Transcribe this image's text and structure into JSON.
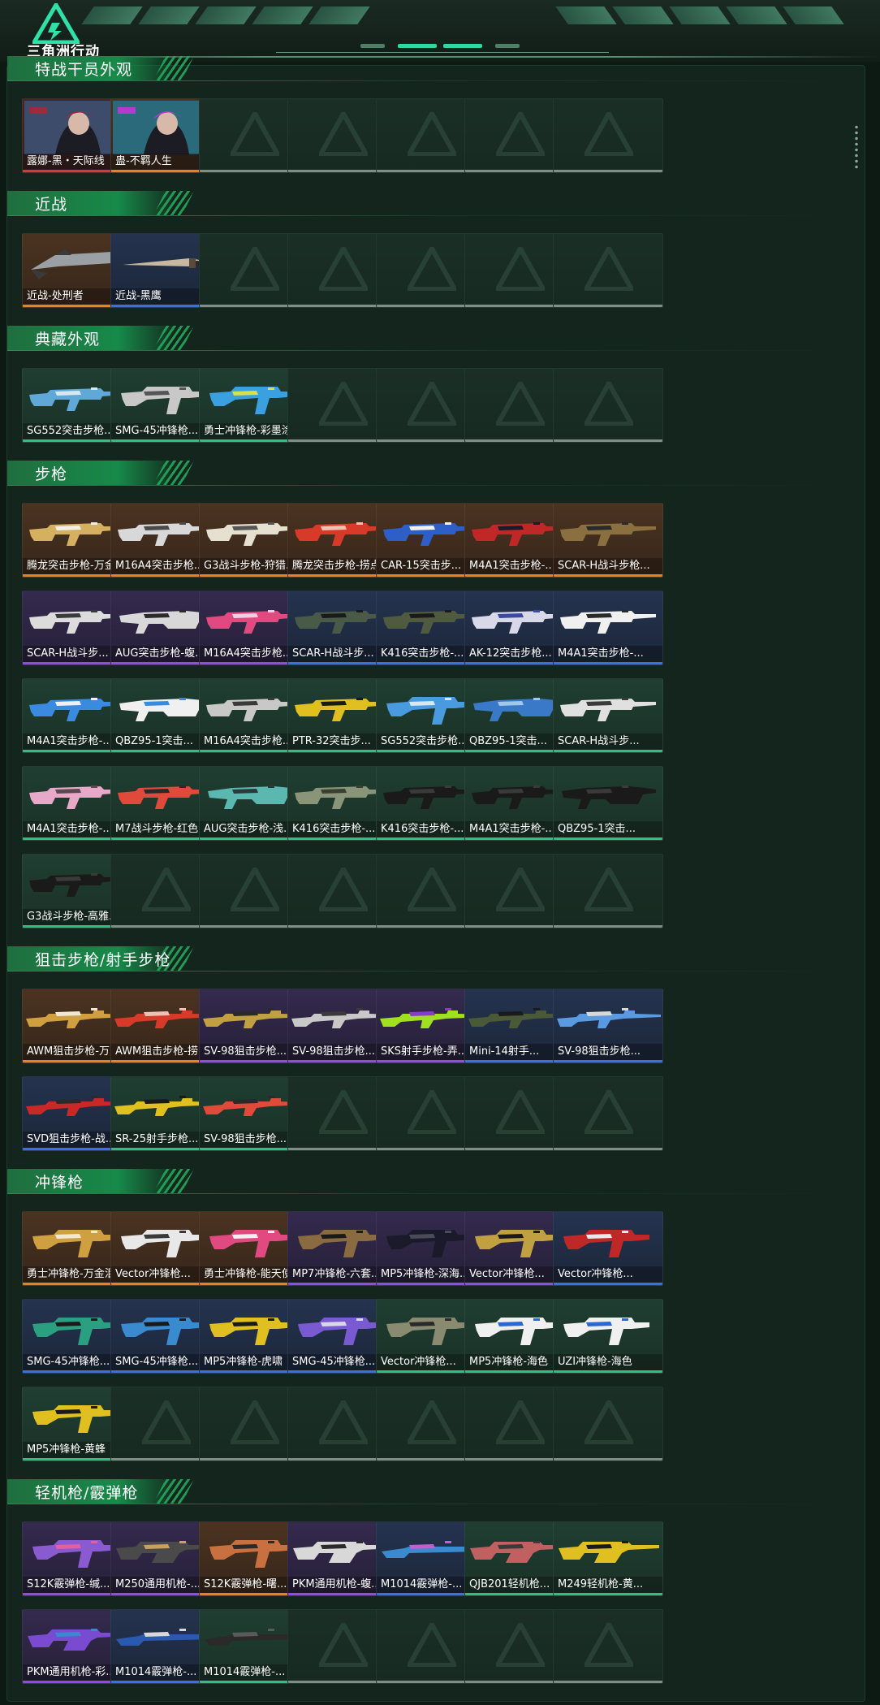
{
  "app": {
    "brand": "三角洲行动"
  },
  "colors": {
    "orange": "#e8821f",
    "red": "#d23b36",
    "purple": "#8a4fe0",
    "blue": "#3474e2",
    "green": "#2fbf82",
    "accent": "#2fd8a0"
  },
  "sections": [
    {
      "title": "特战干员外观",
      "items": [
        {
          "label": "露娜-黑・天际线",
          "rarity": "red",
          "kind": "portrait",
          "c1": "#3d4c6a",
          "c2": "#9c2a3c"
        },
        {
          "label": "蛊-不羁人生",
          "rarity": "orange",
          "kind": "portrait",
          "c1": "#2a6a7a",
          "c2": "#b53bcf"
        }
      ]
    },
    {
      "title": "近战",
      "items": [
        {
          "label": "近战-处刑者",
          "rarity": "orange",
          "kind": "blade",
          "c1": "#9aa0a3",
          "c2": "#3a3a3a"
        },
        {
          "label": "近战-黑鹰",
          "rarity": "blue",
          "kind": "knife",
          "c1": "#c8b8a0",
          "c2": "#2a2a2a"
        }
      ]
    },
    {
      "title": "典藏外观",
      "items": [
        {
          "label": "SG552突击步枪...",
          "rarity": "green",
          "kind": "rifle",
          "c1": "#5fa8d8",
          "c2": "#d8e8f0"
        },
        {
          "label": "SMG-45冲锋枪...",
          "rarity": "green",
          "kind": "smg",
          "c1": "#c8c8c8",
          "c2": "#555555"
        },
        {
          "label": "勇士冲锋枪-彩墨涂...",
          "rarity": "green",
          "kind": "smg",
          "c1": "#3aa0e0",
          "c2": "#d8e04a"
        }
      ]
    },
    {
      "title": "步枪",
      "items": [
        {
          "label": "腾龙突击步枪-万金...",
          "rarity": "orange",
          "kind": "rifle",
          "c1": "#d4b060",
          "c2": "#f2efe6"
        },
        {
          "label": "M16A4突击步枪...",
          "rarity": "orange",
          "kind": "rifle",
          "c1": "#d8d8d8",
          "c2": "#4a4a4a"
        },
        {
          "label": "G3战斗步枪-狩猎...",
          "rarity": "orange",
          "kind": "rifle",
          "c1": "#e6e0d0",
          "c2": "#555555"
        },
        {
          "label": "腾龙突击步枪-捞点...",
          "rarity": "orange",
          "kind": "rifle",
          "c1": "#d83a2a",
          "c2": "#f0c0b0"
        },
        {
          "label": "CAR-15突击步...",
          "rarity": "orange",
          "kind": "rifle",
          "c1": "#2e5fc8",
          "c2": "#f0f0f0"
        },
        {
          "label": "M4A1突击步枪-...",
          "rarity": "orange",
          "kind": "rifle",
          "c1": "#c02828",
          "c2": "#1a1a2a"
        },
        {
          "label": "SCAR-H战斗步枪...",
          "rarity": "orange",
          "kind": "rifle",
          "c1": "#8a7040",
          "c2": "#2a2a2a"
        },
        {
          "label": "SCAR-H战斗步...",
          "rarity": "purple",
          "kind": "rifle",
          "c1": "#dcdcdc",
          "c2": "#3a3a3a"
        },
        {
          "label": "AUG突击步枪-蝮...",
          "rarity": "purple",
          "kind": "bullpup",
          "c1": "#d8d8d8",
          "c2": "#2a2a2a"
        },
        {
          "label": "M16A4突击步枪...",
          "rarity": "purple",
          "kind": "rifle",
          "c1": "#e04a80",
          "c2": "#f0d0e0"
        },
        {
          "label": "SCAR-H战斗步...",
          "rarity": "blue",
          "kind": "rifle",
          "c1": "#4a5a48",
          "c2": "#1a1a1a"
        },
        {
          "label": "K416突击步枪-...",
          "rarity": "blue",
          "kind": "rifle",
          "c1": "#505a40",
          "c2": "#1a1a1a"
        },
        {
          "label": "AK-12突击步枪...",
          "rarity": "blue",
          "kind": "rifle",
          "c1": "#d8d8e8",
          "c2": "#3a4aa0"
        },
        {
          "label": "M4A1突击步枪-...",
          "rarity": "blue",
          "kind": "rifle",
          "c1": "#f0f0f0",
          "c2": "#2a2a2a"
        },
        {
          "label": "M4A1突击步枪-...",
          "rarity": "green",
          "kind": "rifle",
          "c1": "#3a8ae0",
          "c2": "#f0f0f0"
        },
        {
          "label": "QBZ95-1突击...",
          "rarity": "green",
          "kind": "bullpup",
          "c1": "#f0f0f0",
          "c2": "#3a8ae0"
        },
        {
          "label": "M16A4突击步枪...",
          "rarity": "green",
          "kind": "rifle",
          "c1": "#c8c8c8",
          "c2": "#3a3a3a"
        },
        {
          "label": "PTR-32突击步...",
          "rarity": "green",
          "kind": "rifle",
          "c1": "#e0c020",
          "c2": "#1a1a1a"
        },
        {
          "label": "SG552突击步枪...",
          "rarity": "green",
          "kind": "smg",
          "c1": "#4a9ae0",
          "c2": "#d8e8f0"
        },
        {
          "label": "QBZ95-1突击...",
          "rarity": "green",
          "kind": "bullpup",
          "c1": "#3a78c8",
          "c2": "#a0c8e8"
        },
        {
          "label": "SCAR-H战斗步...",
          "rarity": "green",
          "kind": "rifle",
          "c1": "#e0e0e0",
          "c2": "#3a3a3a"
        },
        {
          "label": "M4A1突击步枪-...",
          "rarity": "green",
          "kind": "rifle",
          "c1": "#e8a8c8",
          "c2": "#5a4a50"
        },
        {
          "label": "M7战斗步枪-红色...",
          "rarity": "green",
          "kind": "rifle",
          "c1": "#e04a3a",
          "c2": "#2a2a2a"
        },
        {
          "label": "AUG突击步枪-浅...",
          "rarity": "green",
          "kind": "bullpup",
          "c1": "#5ab8b0",
          "c2": "#2a3a3a"
        },
        {
          "label": "K416突击步枪-...",
          "rarity": "green",
          "kind": "rifle",
          "c1": "#8a9478",
          "c2": "#3a4030"
        },
        {
          "label": "K416突击步枪-...",
          "rarity": "green",
          "kind": "rifle",
          "c1": "#1a1a1a",
          "c2": "#3a3a3a"
        },
        {
          "label": "M4A1突击步枪-...",
          "rarity": "green",
          "kind": "rifle",
          "c1": "#1a1a1a",
          "c2": "#3a3a3a"
        },
        {
          "label": "QBZ95-1突击...",
          "rarity": "green",
          "kind": "bullpup",
          "c1": "#1a1a1a",
          "c2": "#3a3a3a"
        },
        {
          "label": "G3战斗步枪-高雅...",
          "rarity": "green",
          "kind": "rifle",
          "c1": "#1a1a1a",
          "c2": "#3a3a3a"
        }
      ]
    },
    {
      "title": "狙击步枪/射手步枪",
      "items": [
        {
          "label": "AWM狙击步枪-万...",
          "rarity": "orange",
          "kind": "sniper",
          "c1": "#d0a040",
          "c2": "#f0e8d0"
        },
        {
          "label": "AWM狙击步枪-捞...",
          "rarity": "orange",
          "kind": "sniper",
          "c1": "#d83a2a",
          "c2": "#f0c0b0"
        },
        {
          "label": "SV-98狙击步枪...",
          "rarity": "purple",
          "kind": "sniper",
          "c1": "#c0a040",
          "c2": "#2a2a2a"
        },
        {
          "label": "SV-98狙击步枪...",
          "rarity": "purple",
          "kind": "sniper",
          "c1": "#c8c8c8",
          "c2": "#3a3a3a"
        },
        {
          "label": "SKS射手步枪-弄...",
          "rarity": "purple",
          "kind": "sniper",
          "c1": "#a0e020",
          "c2": "#8a3ad0"
        },
        {
          "label": "Mini-14射手...",
          "rarity": "blue",
          "kind": "sniper",
          "c1": "#4a5a38",
          "c2": "#1a1a1a"
        },
        {
          "label": "SV-98狙击步枪...",
          "rarity": "blue",
          "kind": "sniper",
          "c1": "#5a9ae0",
          "c2": "#d8d8d8"
        },
        {
          "label": "SVD狙击步枪-战...",
          "rarity": "blue",
          "kind": "sniper",
          "c1": "#c82828",
          "c2": "#2a2a2a"
        },
        {
          "label": "SR-25射手步枪...",
          "rarity": "green",
          "kind": "sniper",
          "c1": "#e0c020",
          "c2": "#1a1a1a"
        },
        {
          "label": "SV-98狙击步枪...",
          "rarity": "green",
          "kind": "sniper",
          "c1": "#e04a3a",
          "c2": "#2a2a2a"
        }
      ]
    },
    {
      "title": "冲锋枪",
      "items": [
        {
          "label": "勇士冲锋枪-万金泪...",
          "rarity": "orange",
          "kind": "smg",
          "c1": "#d0a040",
          "c2": "#f0e8d0"
        },
        {
          "label": "Vector冲锋枪...",
          "rarity": "orange",
          "kind": "smg",
          "c1": "#e8e8e8",
          "c2": "#3a3a3a"
        },
        {
          "label": "勇士冲锋枪-能天使...",
          "rarity": "orange",
          "kind": "smg",
          "c1": "#e04a80",
          "c2": "#f0f0f0"
        },
        {
          "label": "MP7冲锋枪-六套...",
          "rarity": "purple",
          "kind": "smg",
          "c1": "#8a6a40",
          "c2": "#1a1a1a"
        },
        {
          "label": "MP5冲锋枪-深海...",
          "rarity": "purple",
          "kind": "smg",
          "c1": "#1a1a2a",
          "c2": "#4a4a5a"
        },
        {
          "label": "Vector冲锋枪...",
          "rarity": "purple",
          "kind": "smg",
          "c1": "#c0a040",
          "c2": "#1a1a1a"
        },
        {
          "label": "Vector冲锋枪...",
          "rarity": "blue",
          "kind": "smg",
          "c1": "#c02828",
          "c2": "#e8e8e8"
        },
        {
          "label": "SMG-45冲锋枪...",
          "rarity": "blue",
          "kind": "smg",
          "c1": "#2aa080",
          "c2": "#1a1a1a"
        },
        {
          "label": "SMG-45冲锋枪...",
          "rarity": "blue",
          "kind": "smg",
          "c1": "#3a8ad0",
          "c2": "#1a1a1a"
        },
        {
          "label": "MP5冲锋枪-虎啸",
          "rarity": "blue",
          "kind": "smg",
          "c1": "#e0c020",
          "c2": "#1a1a1a"
        },
        {
          "label": "SMG-45冲锋枪...",
          "rarity": "blue",
          "kind": "smg",
          "c1": "#7a5ad0",
          "c2": "#d8d8e8"
        },
        {
          "label": "Vector冲锋枪...",
          "rarity": "green",
          "kind": "smg",
          "c1": "#8a8a70",
          "c2": "#2a2a2a"
        },
        {
          "label": "MP5冲锋枪-海色",
          "rarity": "green",
          "kind": "smg",
          "c1": "#f0f0f0",
          "c2": "#2a6ad0"
        },
        {
          "label": "UZI冲锋枪-海色",
          "rarity": "green",
          "kind": "smg",
          "c1": "#f0f0f0",
          "c2": "#2a6ad0"
        },
        {
          "label": "MP5冲锋枪-黄蜂",
          "rarity": "green",
          "kind": "smg",
          "c1": "#e0c020",
          "c2": "#1a1a1a"
        }
      ]
    },
    {
      "title": "轻机枪/霰弹枪",
      "items": [
        {
          "label": "S12K霰弹枪-缄...",
          "rarity": "purple",
          "kind": "smg",
          "c1": "#8a5ad0",
          "c2": "#e060a0"
        },
        {
          "label": "M250通用机枪-...",
          "rarity": "purple",
          "kind": "lmg",
          "c1": "#4a4a4a",
          "c2": "#c8a060"
        },
        {
          "label": "S12K霰弹枪-曙...",
          "rarity": "orange",
          "kind": "smg",
          "c1": "#c87040",
          "c2": "#2a2a2a"
        },
        {
          "label": "PKM通用机枪-蝮...",
          "rarity": "purple",
          "kind": "lmg",
          "c1": "#d8d8d8",
          "c2": "#2a2a2a"
        },
        {
          "label": "M1014霰弹枪-...",
          "rarity": "blue",
          "kind": "shotgun",
          "c1": "#3a8ad0",
          "c2": "#c060d0"
        },
        {
          "label": "QJB201轻机枪...",
          "rarity": "green",
          "kind": "lmg",
          "c1": "#c06060",
          "c2": "#3a3a3a"
        },
        {
          "label": "M249轻机枪-黄...",
          "rarity": "green",
          "kind": "lmg",
          "c1": "#e0c020",
          "c2": "#1a1a1a"
        },
        {
          "label": "PKM通用机枪-彩...",
          "rarity": "purple",
          "kind": "lmg",
          "c1": "#7a4ad0",
          "c2": "#3a8ad0"
        },
        {
          "label": "M1014霰弹枪-...",
          "rarity": "blue",
          "kind": "shotgun",
          "c1": "#2a5ab0",
          "c2": "#d8d8d8"
        },
        {
          "label": "M1014霰弹枪-...",
          "rarity": "green",
          "kind": "shotgun",
          "c1": "#2a2a2a",
          "c2": "#5a5a5a"
        }
      ]
    }
  ]
}
